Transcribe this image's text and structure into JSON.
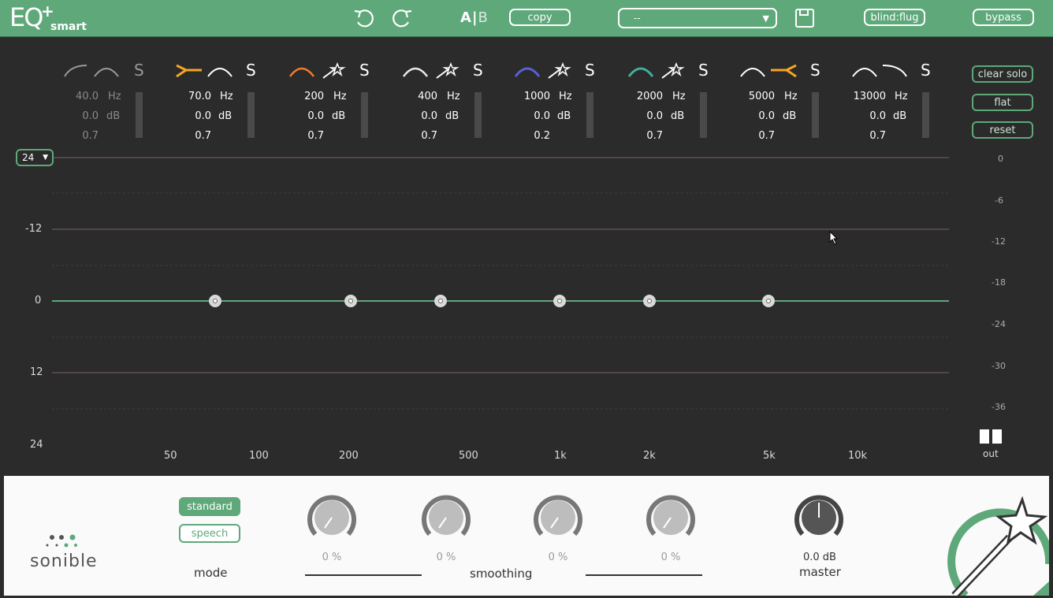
{
  "app": {
    "logo_text": "EQ",
    "logo_plus": "+",
    "logo_sub": "smart"
  },
  "toolbar": {
    "ab_a": "A",
    "ab_sep": "|",
    "ab_b": "B",
    "copy_label": "copy",
    "preset_value": "--",
    "blind_label": "blind:flug",
    "bypass_label": "bypass"
  },
  "bands": [
    {
      "freq": "40.0",
      "gain": "0.0",
      "q": "0.7",
      "color": "#bdbdbd"
    },
    {
      "freq": "70.0",
      "gain": "0.0",
      "q": "0.7",
      "color": "#f5a623"
    },
    {
      "freq": "200",
      "gain": "0.0",
      "q": "0.7",
      "color": "#f07c2a"
    },
    {
      "freq": "400",
      "gain": "0.0",
      "q": "0.7",
      "color": "#e8e8e8"
    },
    {
      "freq": "1000",
      "gain": "0.0",
      "q": "0.2",
      "color": "#5a5fd6"
    },
    {
      "freq": "2000",
      "gain": "0.0",
      "q": "0.7",
      "color": "#3fae9a"
    },
    {
      "freq": "5000",
      "gain": "0.0",
      "q": "0.7",
      "color": "#f5a623"
    },
    {
      "freq": "13000",
      "gain": "0.0",
      "q": "0.7",
      "color": "#e8e8e8"
    }
  ],
  "units": {
    "hz": "Hz",
    "db": "dB",
    "solo": "S"
  },
  "side": {
    "clear_solo": "clear solo",
    "flat": "flat",
    "reset": "reset"
  },
  "range_select": "24",
  "left_axis": [
    "-12",
    "0",
    "12",
    "24"
  ],
  "right_axis": [
    "0",
    "-6",
    "-12",
    "-18",
    "-24",
    "-30",
    "-36"
  ],
  "freq_axis": [
    "50",
    "100",
    "200",
    "500",
    "1k",
    "2k",
    "5k",
    "10k"
  ],
  "out_label": "out",
  "bottom": {
    "brand": "sonible",
    "mode_standard": "standard",
    "mode_speech": "speech",
    "mode_label": "mode",
    "knob_values": [
      "0 %",
      "0 %",
      "0 %",
      "0 %"
    ],
    "smoothing_label": "smoothing",
    "master_value": "0.0 dB",
    "master_label": "master"
  },
  "colors": {
    "accent": "#5ea87a",
    "bg": "#2b2b2b",
    "curve": "#5ea87a"
  }
}
